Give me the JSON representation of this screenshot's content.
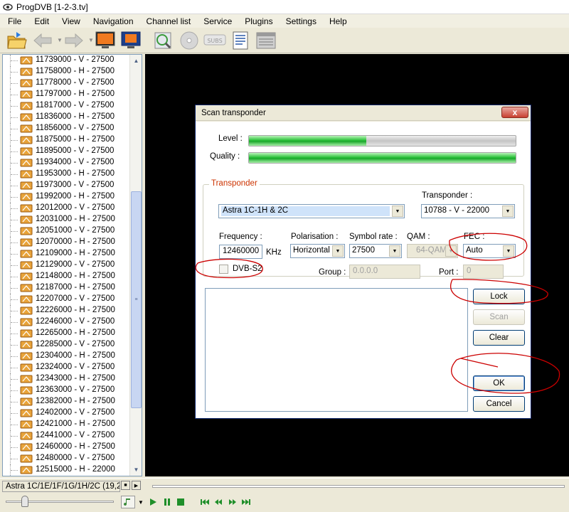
{
  "window": {
    "title": "ProgDVB [1-2-3.tv]"
  },
  "menu": [
    "File",
    "Edit",
    "View",
    "Navigation",
    "Channel list",
    "Service",
    "Plugins",
    "Settings",
    "Help"
  ],
  "toolbar": {
    "icons": [
      "open-folder-icon",
      "back-arrow-icon",
      "forward-arrow-icon",
      "monitor-icon",
      "fullscreen-icon",
      "scan-icon",
      "disc-icon",
      "subs-icon",
      "list-icon",
      "epg-icon"
    ],
    "subs_label": "SUBS"
  },
  "channels": [
    "11739000 - V - 27500",
    "11758000 - H - 27500",
    "11778000 - V - 27500",
    "11797000 - H - 27500",
    "11817000 - V - 27500",
    "11836000 - H - 27500",
    "11856000 - V - 27500",
    "11875000 - H - 27500",
    "11895000 - V - 27500",
    "11934000 - V - 27500",
    "11953000 - H - 27500",
    "11973000 - V - 27500",
    "11992000 - H - 27500",
    "12012000 - V - 27500",
    "12031000 - H - 27500",
    "12051000 - V - 27500",
    "12070000 - H - 27500",
    "12109000 - H - 27500",
    "12129000 - V - 27500",
    "12148000 - H - 27500",
    "12187000 - H - 27500",
    "12207000 - V - 27500",
    "12226000 - H - 27500",
    "12246000 - V - 27500",
    "12265000 - H - 27500",
    "12285000 - V - 27500",
    "12304000 - H - 27500",
    "12324000 - V - 27500",
    "12343000 - H - 27500",
    "12363000 - V - 27500",
    "12382000 - H - 27500",
    "12402000 - V - 27500",
    "12421000 - H - 27500",
    "12441000 - V - 27500",
    "12460000 - H - 27500",
    "12480000 - V - 27500",
    "12515000 - H - 22000"
  ],
  "status": {
    "text": "Astra 1C/1E/1F/1G/1H/2C (19,2"
  },
  "dialog": {
    "title": "Scan transponder",
    "close_label": "x",
    "level_label": "Level :",
    "quality_label": "Quality :",
    "level_value": 0.44,
    "quality_value": 1.0,
    "group_label": "Transponder",
    "satellite_value": "Astra 1C-1H & 2C",
    "transponder_label": "Transponder :",
    "transponder_value": "10788 - V - 22000",
    "frequency_label": "Frequency :",
    "frequency_value": "12460000",
    "frequency_unit": "KHz",
    "polarisation_label": "Polarisation :",
    "polarisation_value": "Horizontal",
    "symbol_rate_label": "Symbol rate :",
    "symbol_rate_value": "27500",
    "qam_label": "QAM :",
    "qam_value": "64-QAM",
    "fec_label": "FEC :",
    "fec_value": "Auto",
    "dvbs2_label": "DVB-S2",
    "group_field_label": "Group :",
    "group_value": "0.0.0.0",
    "port_label": "Port :",
    "port_value": "0",
    "buttons": {
      "lock": "Lock",
      "scan": "Scan",
      "clear": "Clear",
      "ok": "OK",
      "cancel": "Cancel"
    }
  },
  "colors": {
    "accent": "#cc3300",
    "meter_green": "#19a82a",
    "annotation": "#cc0000"
  }
}
